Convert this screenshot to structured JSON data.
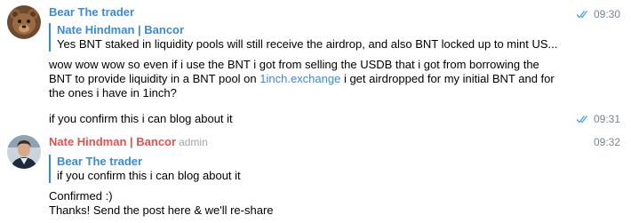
{
  "messages": [
    {
      "sender": "Bear The trader",
      "time": "09:30",
      "reply": {
        "author": "Nate Hindman | Bancor",
        "text": "Yes BNT staked in liquidity pools will still receive the airdrop, and also BNT locked up to mint US..."
      },
      "text_before_link": "wow wow wow so even if i use the BNT i got from selling the USDB that i got from borrowing the BNT to provide liquidity in a BNT pool on ",
      "link_text": "1inch.exchange",
      "text_after_link": " i get airdropped for my initial BNT and for the ones i have in 1inch?"
    },
    {
      "text": "if you confirm this i can blog about it",
      "time": "09:31"
    },
    {
      "sender": "Nate Hindman | Bancor",
      "role": "admin",
      "time": "09:32",
      "reply": {
        "author": "Bear The trader",
        "text": "if you confirm this i can blog about it"
      },
      "lines": [
        "Confirmed :)",
        "Thanks! Send the post here & we'll re-share"
      ]
    }
  ],
  "colors": {
    "link": "#3a8ad6",
    "admin_name": "#e0524f",
    "read_check": "#4fa3e0"
  }
}
